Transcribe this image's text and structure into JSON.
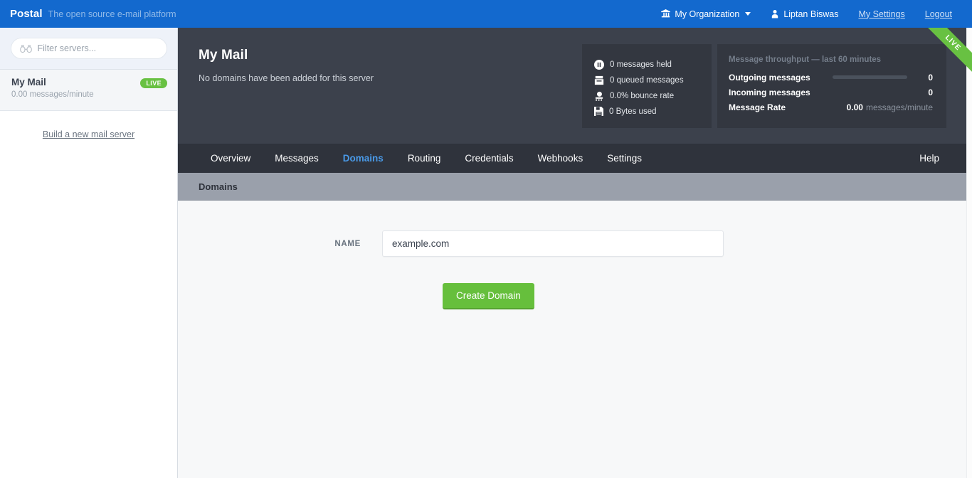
{
  "topbar": {
    "brand": "Postal",
    "tagline": "The open source e-mail platform",
    "org": {
      "label": "My Organization",
      "icon": "bank-icon"
    },
    "user": {
      "label": "Liptan Biswas",
      "icon": "user-icon"
    },
    "settings_link": "My Settings",
    "logout_link": "Logout",
    "bg": "#1369ce"
  },
  "sidebar": {
    "filter": {
      "placeholder": "Filter servers...",
      "value": "",
      "icon": "binoculars-icon"
    },
    "servers": [
      {
        "name": "My Mail",
        "rate": "0.00 messages/minute",
        "badge": "LIVE"
      }
    ],
    "build_link": "Build a new mail server"
  },
  "hero": {
    "title": "My Mail",
    "subtitle": "No domains have been added for this server",
    "ribbon": "LIVE",
    "stats": [
      {
        "icon": "pause-circle-icon",
        "text": "0 messages held"
      },
      {
        "icon": "inbox-icon",
        "text": "0 queued messages"
      },
      {
        "icon": "bounce-icon",
        "text": "0.0% bounce rate"
      },
      {
        "icon": "floppy-disk-icon",
        "text": "0 Bytes used"
      }
    ],
    "throughput": {
      "heading": "Message throughput — last 60 minutes",
      "rows": [
        {
          "label": "Outgoing messages",
          "value": "0",
          "has_bar": true
        },
        {
          "label": "Incoming messages",
          "value": "0",
          "has_bar": false
        }
      ],
      "rate_label": "Message Rate",
      "rate_value": "0.00",
      "rate_unit": "messages/minute"
    }
  },
  "tabs": [
    {
      "label": "Overview",
      "active": false
    },
    {
      "label": "Messages",
      "active": false
    },
    {
      "label": "Domains",
      "active": true
    },
    {
      "label": "Routing",
      "active": false
    },
    {
      "label": "Credentials",
      "active": false
    },
    {
      "label": "Webhooks",
      "active": false
    },
    {
      "label": "Settings",
      "active": false
    }
  ],
  "help_label": "Help",
  "breadcrumb": {
    "current": "Domains"
  },
  "form": {
    "name_label": "NAME",
    "name_value": "example.com",
    "name_placeholder": "",
    "submit_label": "Create Domain"
  },
  "colors": {
    "brand_blue": "#1369ce",
    "accent_green": "#66bf3c",
    "hero_dark": "#3c414c",
    "tabs_dark": "#2f333c",
    "crumb_gray": "#9aa0ab",
    "active_tab_blue": "#4a9ae8"
  }
}
